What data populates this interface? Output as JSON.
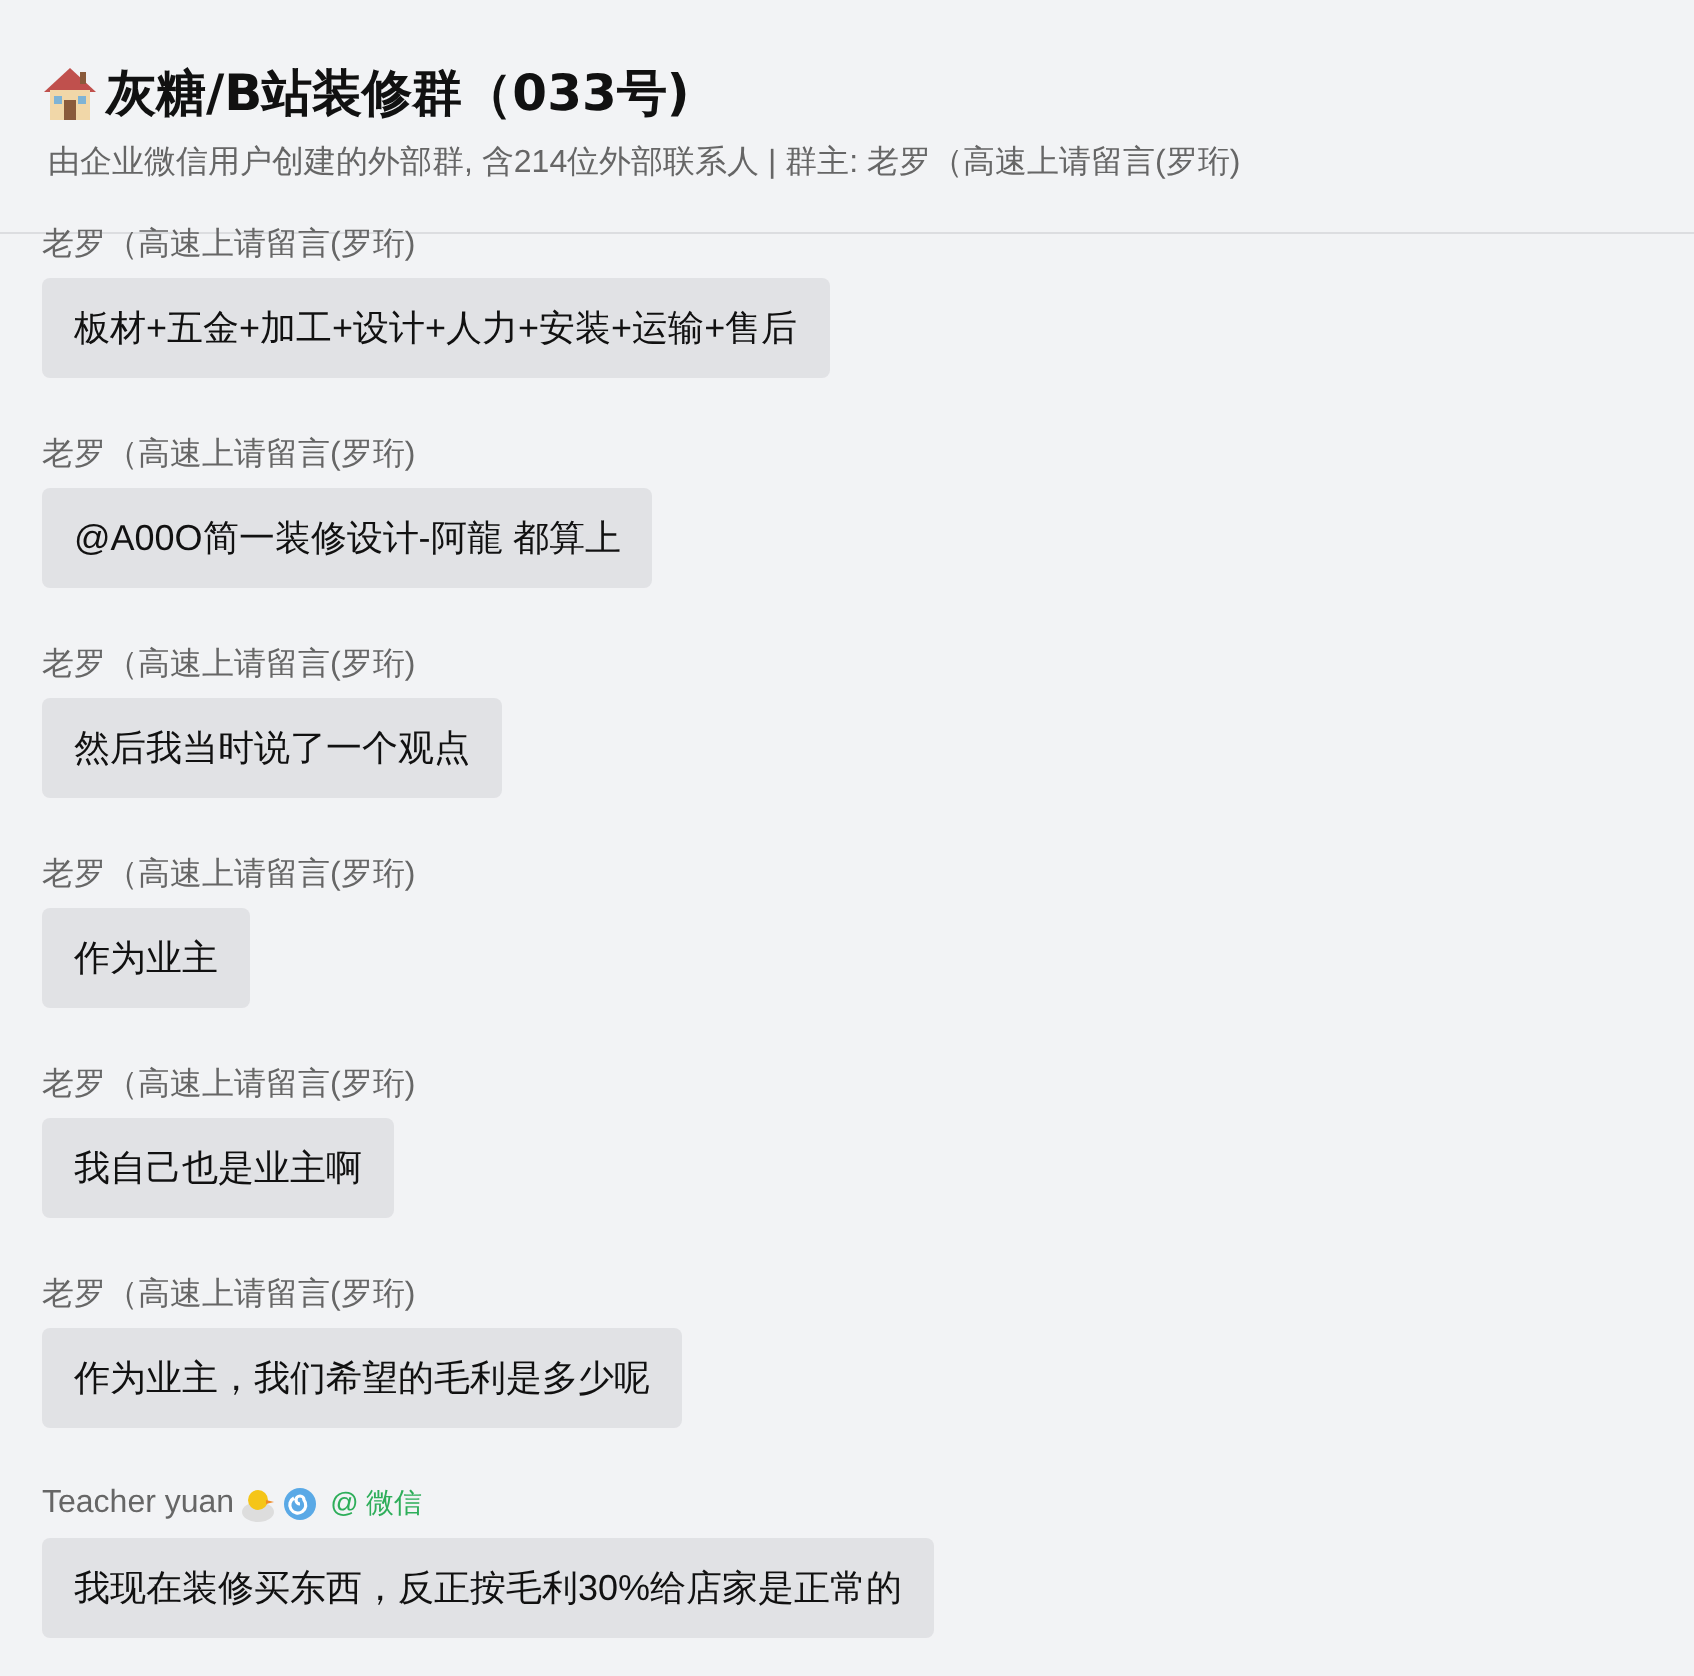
{
  "header": {
    "title": "灰糖/B站装修群（033号)",
    "subtitle": "由企业微信用户创建的外部群, 含214位外部联系人  | 群主: 老罗（高速上请留言(罗珩)"
  },
  "messages": [
    {
      "sender": "老罗（高速上请留言(罗珩)",
      "text": "板材+五金+加工+设计+人力+安装+运输+售后"
    },
    {
      "sender": "老罗（高速上请留言(罗珩)",
      "text": "@A00O简一装修设计-阿龍  都算上"
    },
    {
      "sender": "老罗（高速上请留言(罗珩)",
      "text": "然后我当时说了一个观点"
    },
    {
      "sender": "老罗（高速上请留言(罗珩)",
      "text": "作为业主"
    },
    {
      "sender": "老罗（高速上请留言(罗珩)",
      "text": "我自己也是业主啊"
    },
    {
      "sender": "老罗（高速上请留言(罗珩)",
      "text": "作为业主，我们希望的毛利是多少呢"
    },
    {
      "sender": "Teacher yuan",
      "source": "@ 微信",
      "text": "我现在装修买东西，反正按毛利30%给店家是正常的"
    }
  ]
}
